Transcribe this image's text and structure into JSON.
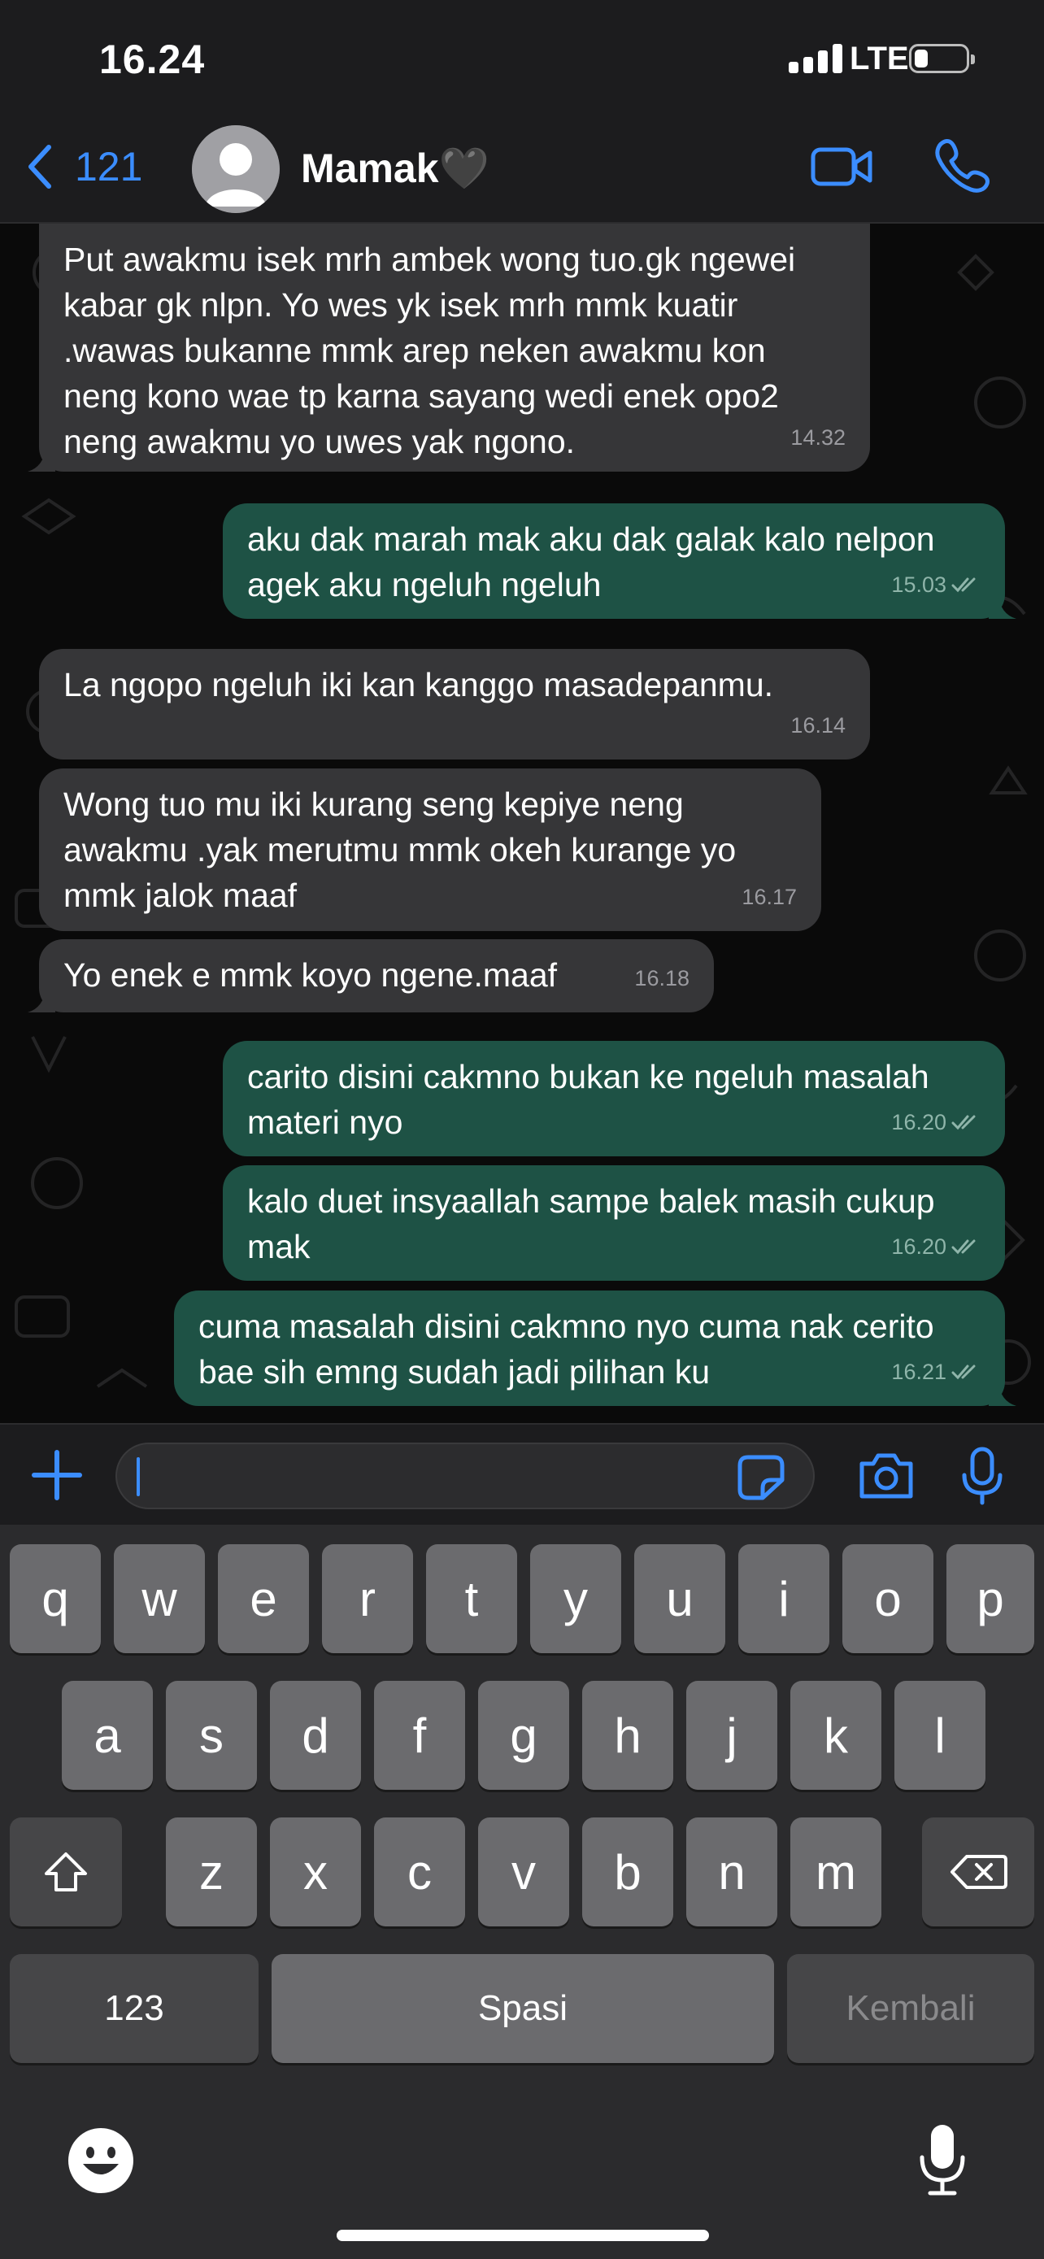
{
  "status_bar": {
    "time": "16.24",
    "network": "LTE",
    "battery_level": 0.25
  },
  "header": {
    "back_count": "121",
    "contact_name": "Mamak🖤",
    "icons": [
      "chevron-left-icon",
      "avatar-placeholder",
      "video-call-icon",
      "phone-icon"
    ]
  },
  "messages": [
    {
      "direction": "incoming",
      "text": "Put awakmu isek mrh ambek wong tuo.gk ngewei kabar gk nlpn. Yo wes yk isek mrh mmk kuatir .wawas bukanne mmk arep neken awakmu kon neng kono wae tp karna sayang wedi enek opo2 neng awakmu yo uwes yak ngono.",
      "time": "14.32"
    },
    {
      "direction": "outgoing",
      "text": "aku dak marah mak aku dak galak kalo nelpon agek aku ngeluh ngeluh",
      "time": "15.03",
      "status": "read"
    },
    {
      "direction": "incoming",
      "text": "La ngopo ngeluh iki kan kanggo masadepanmu.",
      "time": "16.14"
    },
    {
      "direction": "incoming",
      "text": "Wong tuo mu iki kurang seng kepiye neng awakmu .yak merutmu mmk  okeh kurange yo mmk jalok maaf",
      "time": "16.17"
    },
    {
      "direction": "incoming",
      "text": "Yo enek e mmk koyo ngene.maaf",
      "time": "16.18"
    },
    {
      "direction": "outgoing",
      "text": "carito disini cakmno bukan ke ngeluh masalah materi nyo",
      "time": "16.20",
      "status": "read"
    },
    {
      "direction": "outgoing",
      "text": "kalo duet insyaallah sampe balek masih cukup mak",
      "time": "16.20",
      "status": "read"
    },
    {
      "direction": "outgoing",
      "text": "cuma masalah disini cakmno nyo cuma nak cerito bae sih emng sudah jadi pilihan ku",
      "time": "16.21",
      "status": "read"
    }
  ],
  "input": {
    "value": "",
    "placeholder": "",
    "icons": [
      "plus-icon",
      "sticker-icon",
      "camera-icon",
      "microphone-icon"
    ]
  },
  "keyboard": {
    "row1": [
      "q",
      "w",
      "e",
      "r",
      "t",
      "y",
      "u",
      "i",
      "o",
      "p"
    ],
    "row2": [
      "a",
      "s",
      "d",
      "f",
      "g",
      "h",
      "j",
      "k",
      "l"
    ],
    "row3": [
      "z",
      "x",
      "c",
      "v",
      "b",
      "n",
      "m"
    ],
    "numbers_label": "123",
    "space_label": "Spasi",
    "return_label": "Kembali",
    "icons": [
      "shift-icon",
      "backspace-icon",
      "emoji-icon",
      "dictation-mic-icon"
    ]
  },
  "colors": {
    "accent": "#3b8dff",
    "incoming_bubble": "#363638",
    "outgoing_bubble": "#1e5245",
    "background": "#0a0a0a"
  }
}
